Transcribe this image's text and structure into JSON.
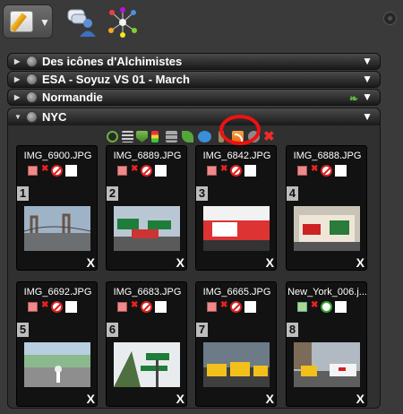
{
  "toolbar": {
    "edit_caret": "▼"
  },
  "collections": [
    {
      "label": "Des icônes d'Alchimistes",
      "expanded": false,
      "has_leaf": false
    },
    {
      "label": "ESA - Soyuz VS 01 - March",
      "expanded": false,
      "has_leaf": false
    },
    {
      "label": "Normandie",
      "expanded": false,
      "has_leaf": true
    }
  ],
  "open_collection": {
    "label": "NYC",
    "expanded": true,
    "items": [
      {
        "index": "1",
        "filename": "IMG_6900.JPG",
        "status": "red",
        "remove": "X"
      },
      {
        "index": "2",
        "filename": "IMG_6889.JPG",
        "status": "red",
        "remove": "X"
      },
      {
        "index": "3",
        "filename": "IMG_6842.JPG",
        "status": "red",
        "remove": "X"
      },
      {
        "index": "4",
        "filename": "IMG_6888.JPG",
        "status": "red",
        "remove": "X"
      },
      {
        "index": "5",
        "filename": "IMG_6692.JPG",
        "status": "red",
        "remove": "X"
      },
      {
        "index": "6",
        "filename": "IMG_6683.JPG",
        "status": "red",
        "remove": "X"
      },
      {
        "index": "7",
        "filename": "IMG_6665.JPG",
        "status": "red",
        "remove": "X"
      },
      {
        "index": "8",
        "filename": "New_York_006.j...",
        "status": "green",
        "remove": "X"
      }
    ]
  },
  "symbols": {
    "expand_down": "▼",
    "collapsed_tri": "▶",
    "expanded_tri": "▼",
    "small_x": "✖",
    "delete": "✖"
  },
  "colors": {
    "background": "#3a3a3a",
    "highlight": "#e11111",
    "rss": "#f08a1e"
  }
}
